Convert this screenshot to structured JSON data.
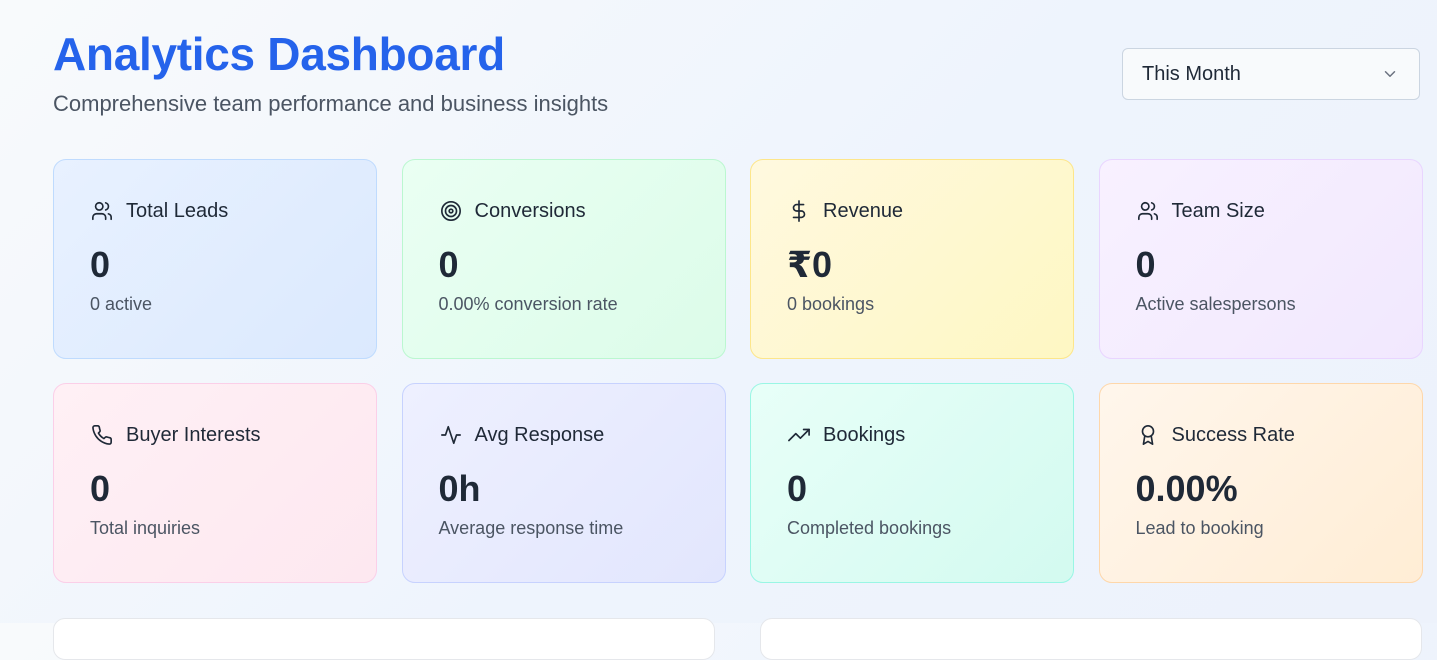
{
  "header": {
    "title": "Analytics Dashboard",
    "subtitle": "Comprehensive team performance and business insights"
  },
  "period_select": {
    "selected": "This Month"
  },
  "cards": [
    {
      "label": "Total Leads",
      "value": "0",
      "sub": "0 active",
      "icon": "users-icon",
      "color": "#dbe9fe"
    },
    {
      "label": "Conversions",
      "value": "0",
      "sub": "0.00% conversion rate",
      "icon": "target-icon",
      "color": "#dcfce9"
    },
    {
      "label": "Revenue",
      "value": "₹0",
      "sub": "0 bookings",
      "icon": "dollar-icon",
      "color": "#fef7c3"
    },
    {
      "label": "Team Size",
      "value": "0",
      "sub": "Active salespersons",
      "icon": "users-icon",
      "color": "#f1e8fe"
    },
    {
      "label": "Buyer Interests",
      "value": "0",
      "sub": "Total inquiries",
      "icon": "phone-icon",
      "color": "#fde8f0"
    },
    {
      "label": "Avg Response",
      "value": "0h",
      "sub": "Average response time",
      "icon": "activity-icon",
      "color": "#e2e6fd"
    },
    {
      "label": "Bookings",
      "value": "0",
      "sub": "Completed bookings",
      "icon": "trending-up-icon",
      "color": "#d3faf0"
    },
    {
      "label": "Success Rate",
      "value": "0.00%",
      "sub": "Lead to booking",
      "icon": "award-icon",
      "color": "#ffedd5"
    }
  ],
  "colors": {
    "accent": "#2563eb",
    "text": "#1f2937",
    "muted": "#4b5563"
  }
}
